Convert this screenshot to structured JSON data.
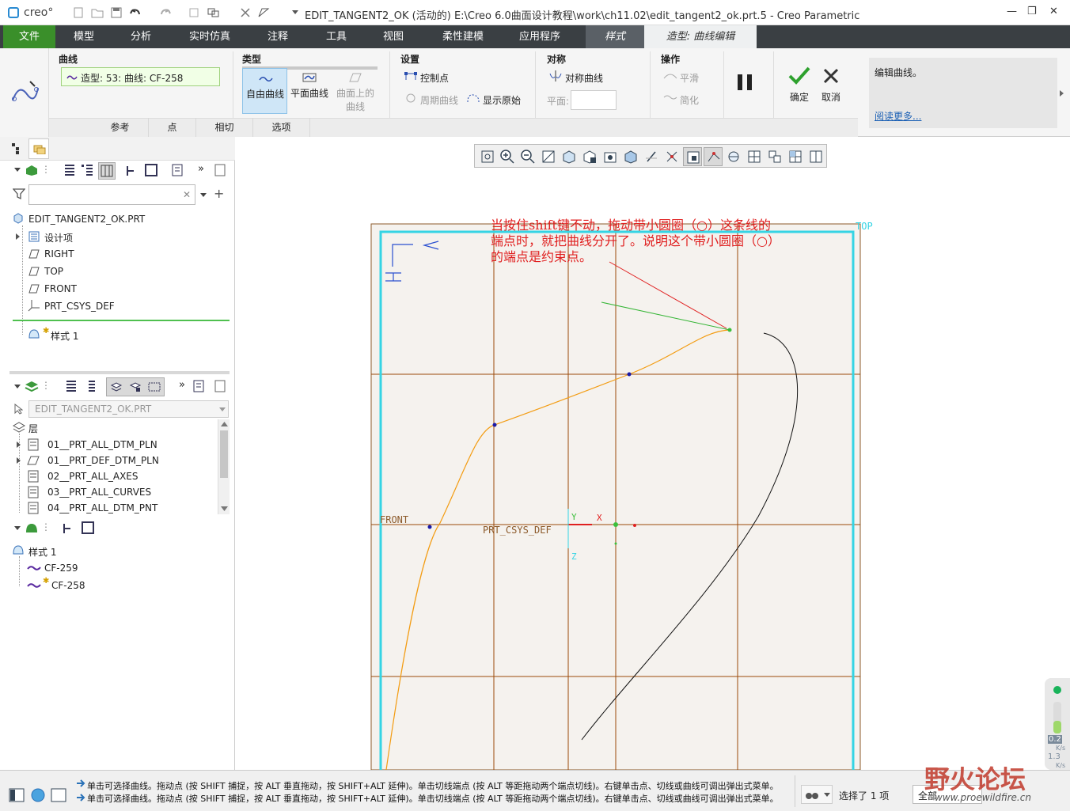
{
  "titlebar": {
    "logo": "creo°",
    "title": "EDIT_TANGENT2_OK (活动的) E:\\Creo 6.0曲面设计教程\\work\\ch11.02\\edit_tangent2_ok.prt.5 - Creo Parametric",
    "minimize": "—",
    "maximize": "❐",
    "close": "✕"
  },
  "menu": {
    "items": [
      "文件",
      "模型",
      "分析",
      "实时仿真",
      "注释",
      "工具",
      "视图",
      "柔性建模",
      "应用程序",
      "样式",
      "造型: 曲线编辑"
    ],
    "accent": "#3a8f2a",
    "active_bg": "#eef0f1"
  },
  "ribbon": {
    "curve_group": "曲线",
    "curve_field": "造型: 53: 曲线: CF-258",
    "type_group": "类型",
    "free_curve": "自由曲线",
    "plane_curve": "平面曲线",
    "surface_curve_1": "曲面上的",
    "surface_curve_2": "曲线",
    "settings_group": "设置",
    "control_points": "控制点",
    "periodic_curve": "周期曲线",
    "show_original": "显示原始",
    "symmetry_group": "对称",
    "symmetric_curve": "对称曲线",
    "plane_label": "平面:",
    "operations_group": "操作",
    "smooth": "平滑",
    "simplify": "简化",
    "ok": "确定",
    "cancel": "取消",
    "help_text": "编辑曲线。",
    "read_more": "阅读更多...",
    "subtabs": [
      "参考",
      "点",
      "相切",
      "选项"
    ]
  },
  "model_tree": {
    "root": "EDIT_TANGENT2_OK.PRT",
    "items": [
      "设计项",
      "RIGHT",
      "TOP",
      "FRONT",
      "PRT_CSYS_DEF"
    ],
    "style_item": "样式 1",
    "star": "✱"
  },
  "layer_tree": {
    "model_select": "EDIT_TANGENT2_OK.PRT",
    "header": "层",
    "layers": [
      "01__PRT_ALL_DTM_PLN",
      "01__PRT_DEF_DTM_PLN",
      "02__PRT_ALL_AXES",
      "03__PRT_ALL_CURVES",
      "04__PRT_ALL_DTM_PNT"
    ]
  },
  "style_tree": {
    "root": "样式 1",
    "curves": [
      "CF-259",
      "CF-258"
    ]
  },
  "canvas": {
    "annotation_lines": [
      "当按住shift键不动，拖动带小圆圈（○）这条线的",
      "端点时，就把曲线分开了。说明这个带小圆圈（○）",
      "的端点是约束点。"
    ],
    "label_top": "TOP",
    "label_front": "FRONT",
    "label_csys": "PRT_CSYS_DEF",
    "axis_x": "X",
    "axis_y": "Y",
    "axis_z": "Z",
    "view_h": "H",
    "view_v": "V"
  },
  "statusbar": {
    "message_1": "单击可选择曲线。拖动点 (按 SHIFT 捕捉，按 ALT 垂直拖动，按 SHIFT+ALT 延伸)。单击切线端点 (按 ALT 等距拖动两个端点切线)。右键单击点、切线或曲线可调出弹出式菜单。",
    "message_2": "单击可选择曲线。拖动点 (按 SHIFT 捕捉，按 ALT 垂直拖动，按 SHIFT+ALT 延伸)。单击切线端点 (按 ALT 等距拖动两个端点切线)。右键单击点、切线或曲线可调出弹出式菜单。",
    "selected": "选择了 1 项",
    "filter": "全部"
  },
  "watermark": {
    "brand": "野火论坛",
    "url": "www.proewildfire.cn"
  },
  "speed": {
    "v1": "0.2",
    "u1": "K/s",
    "v2": "1.3",
    "u2": "K/s"
  }
}
